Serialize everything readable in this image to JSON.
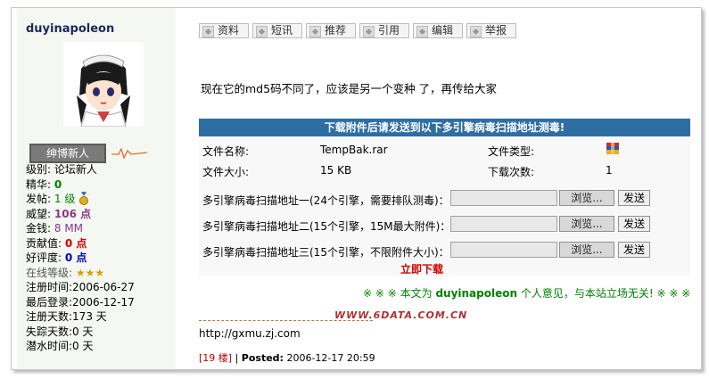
{
  "user": {
    "name": "duyinapoleon",
    "rank": "绅博新人",
    "level": "级别: 论坛新人",
    "essence_label": "精华:",
    "essence": "0",
    "posts_label": "发帖:",
    "posts": "1 级",
    "prestige_label": "威望:",
    "prestige": "106 点",
    "money_label": "金钱:",
    "money": "8 MM",
    "contrib_label": "贡献值:",
    "contrib": "0 点",
    "rating_label": "好评度:",
    "rating": "0 点",
    "online_label": "在线等级:",
    "registered": "注册时间:2006-06-27",
    "last_login": "最后登录:2006-12-17",
    "reg_days": "注册天数:173 天",
    "missing_days": "失踪天数:0 天",
    "dive_time": "潜水时间:0 天"
  },
  "toolbar": [
    "资料",
    "短讯",
    "推荐",
    "引用",
    "编辑",
    "举报"
  ],
  "message": "现在它的md5码不同了，应该是另一个变种 了，再传给大家",
  "download": {
    "header": "下载附件后请发送到以下多引擎病毒扫描地址测毒!",
    "filename_label": "文件名称:",
    "filename": "TempBak.rar",
    "filetype_label": "文件类型:",
    "size_label": "文件大小:",
    "size": "15 KB",
    "count_label": "下载次数:",
    "count": "1",
    "scan1": "多引擎病毒扫描地址一(24个引擎，需要排队测毒)：",
    "scan2": "多引擎病毒扫描地址二(15个引擎，15M最大附件)：",
    "scan3": "多引擎病毒扫描地址三(15个引擎，不限附件大小)：",
    "browse": "浏览...",
    "send": "发送",
    "download_now": "立即下载"
  },
  "notice": {
    "prefix": "※ ※ ※ 本文为",
    "name": "duyinapoleon",
    "suffix": "个人意见，与本站立场无关! ※ ※ ※"
  },
  "signature_logo": "WWW.6DATA.COM.CN",
  "url": "http://gxmu.zj.com",
  "post": {
    "floor": "[19 楼]",
    "sep": "|",
    "posted_label": "Posted:",
    "time": "2006-12-17 20:59"
  }
}
